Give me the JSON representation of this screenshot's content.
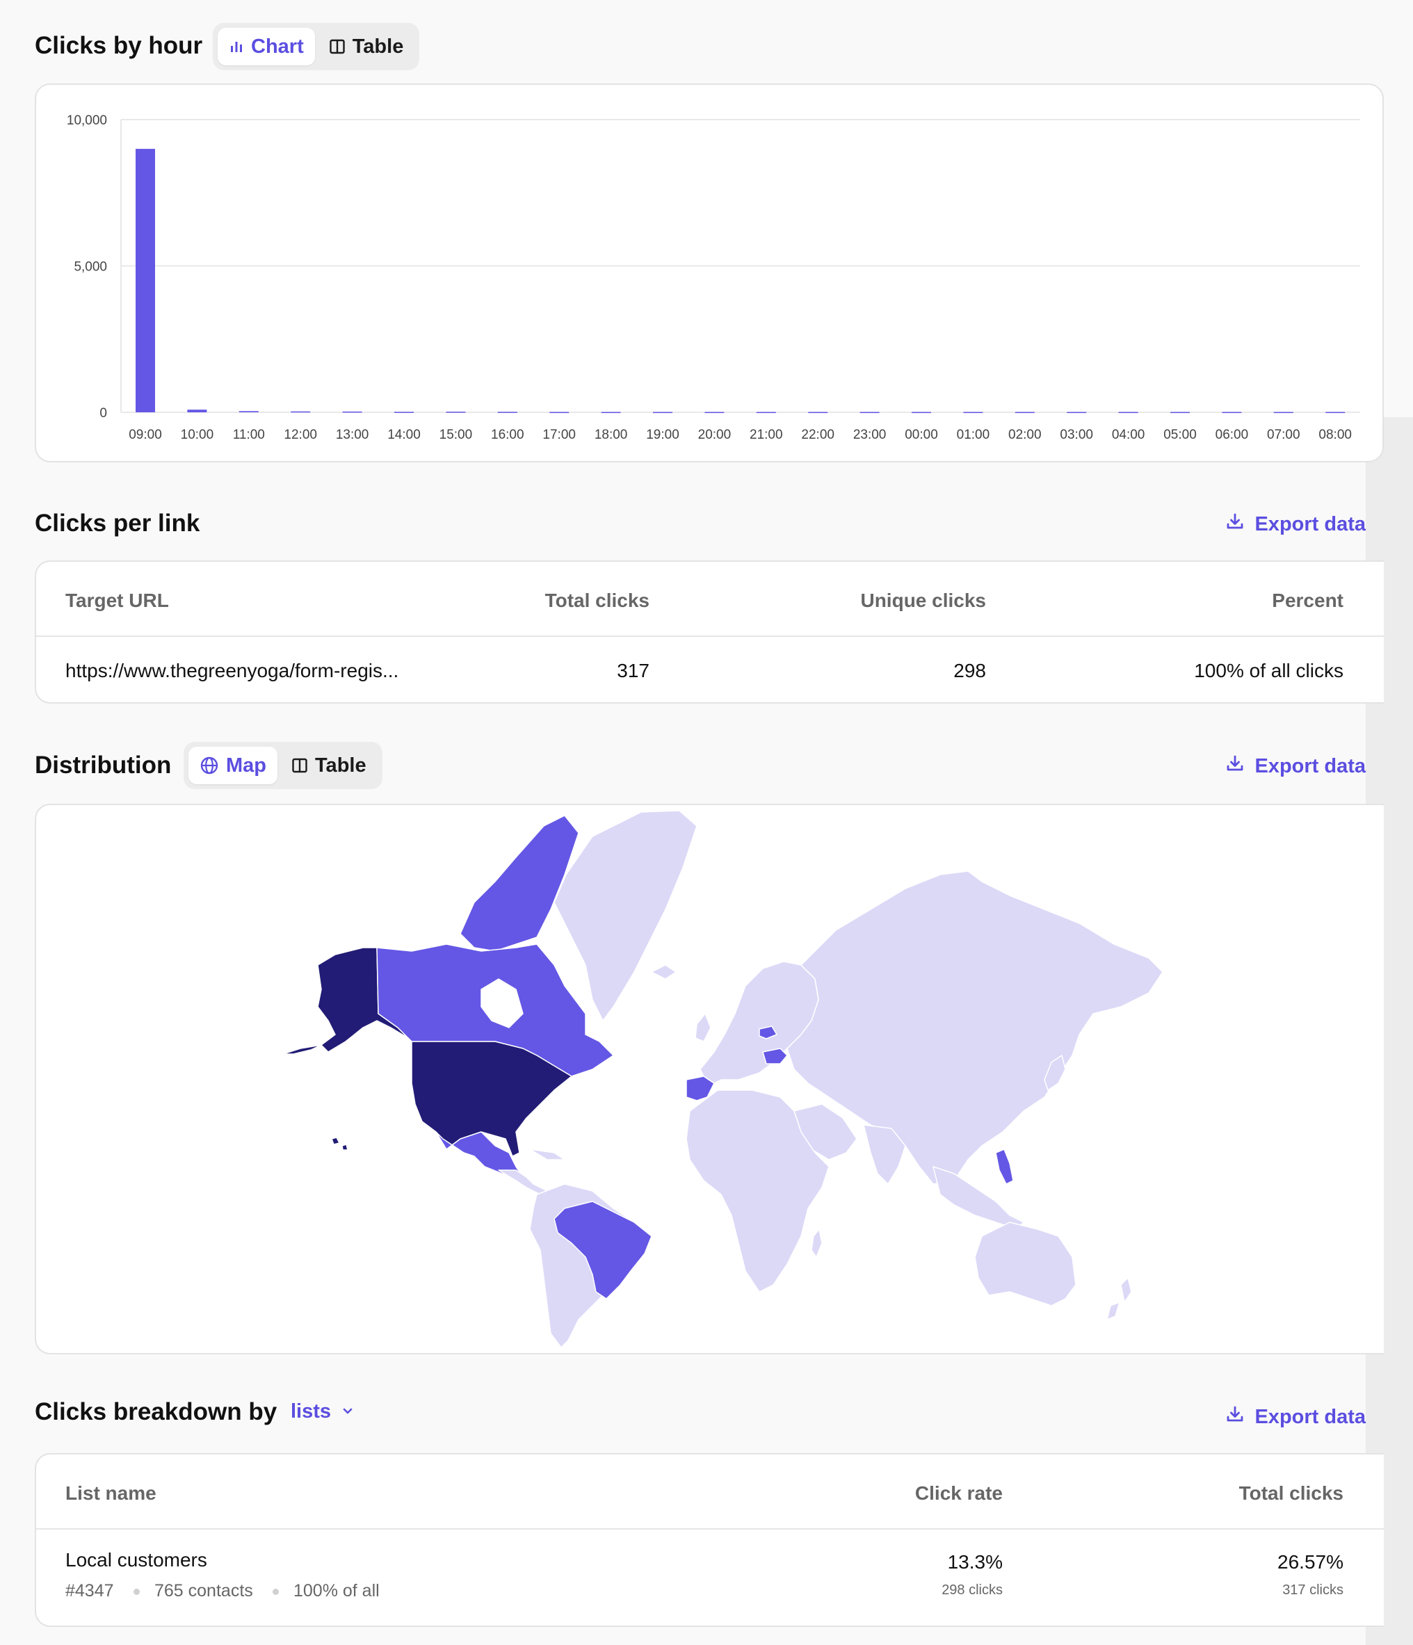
{
  "clicks_by_hour": {
    "title": "Clicks by hour",
    "view_toggle": {
      "chart_label": "Chart",
      "table_label": "Table",
      "selected": "Chart"
    }
  },
  "chart_data": {
    "type": "bar",
    "title": "",
    "xlabel": "",
    "ylabel": "",
    "categories": [
      "09:00",
      "10:00",
      "11:00",
      "12:00",
      "13:00",
      "14:00",
      "15:00",
      "16:00",
      "17:00",
      "18:00",
      "19:00",
      "20:00",
      "21:00",
      "22:00",
      "23:00",
      "00:00",
      "01:00",
      "02:00",
      "03:00",
      "04:00",
      "05:00",
      "06:00",
      "07:00",
      "08:00"
    ],
    "values": [
      9000,
      90,
      40,
      30,
      25,
      15,
      20,
      15,
      10,
      10,
      10,
      10,
      10,
      10,
      10,
      10,
      10,
      10,
      10,
      10,
      10,
      10,
      10,
      10
    ],
    "ylim": [
      0,
      10000
    ],
    "yticks": [
      0,
      5000,
      10000
    ],
    "ytick_labels": [
      "0",
      "5,000",
      "10,000"
    ],
    "grid": true,
    "bar_color": "#6457e5"
  },
  "clicks_per_link": {
    "title": "Clicks per link",
    "export_label": "Export data",
    "columns": [
      "Target URL",
      "Total clicks",
      "Unique clicks",
      "Percent"
    ],
    "rows": [
      {
        "url": "https://www.thegreenyoga/form-regis...",
        "total": "317",
        "unique": "298",
        "percent": "100% of all clicks"
      }
    ]
  },
  "distribution": {
    "title": "Distribution",
    "export_label": "Export data",
    "view_toggle": {
      "map_label": "Map",
      "table_label": "Table",
      "selected": "Map"
    },
    "map": {
      "highlighted_regions": [
        {
          "region": "United States",
          "level": "high",
          "color": "#221c76"
        },
        {
          "region": "Canada",
          "level": "medium",
          "color": "#6457e5"
        },
        {
          "region": "Mexico",
          "level": "medium",
          "color": "#6457e5"
        },
        {
          "region": "Brazil",
          "level": "medium",
          "color": "#6457e5"
        },
        {
          "region": "Spain",
          "level": "medium",
          "color": "#6457e5"
        },
        {
          "region": "Romania",
          "level": "medium",
          "color": "#6457e5"
        },
        {
          "region": "Poland",
          "level": "medium",
          "color": "#6457e5"
        },
        {
          "region": "Philippines",
          "level": "medium",
          "color": "#6457e5"
        }
      ],
      "base_color": "#dcd9f7"
    }
  },
  "breakdown": {
    "title": "Clicks breakdown by",
    "dropdown_value": "lists",
    "export_label": "Export data",
    "columns": [
      "List name",
      "Click rate",
      "Total clicks"
    ],
    "rows": [
      {
        "name": "Local customers",
        "id": "#4347",
        "contacts": "765 contacts",
        "share": "100% of all",
        "click_rate": "13.3%",
        "click_rate_sub": "298 clicks",
        "total_clicks": "26.57%",
        "total_clicks_sub": "317 clicks"
      }
    ]
  }
}
